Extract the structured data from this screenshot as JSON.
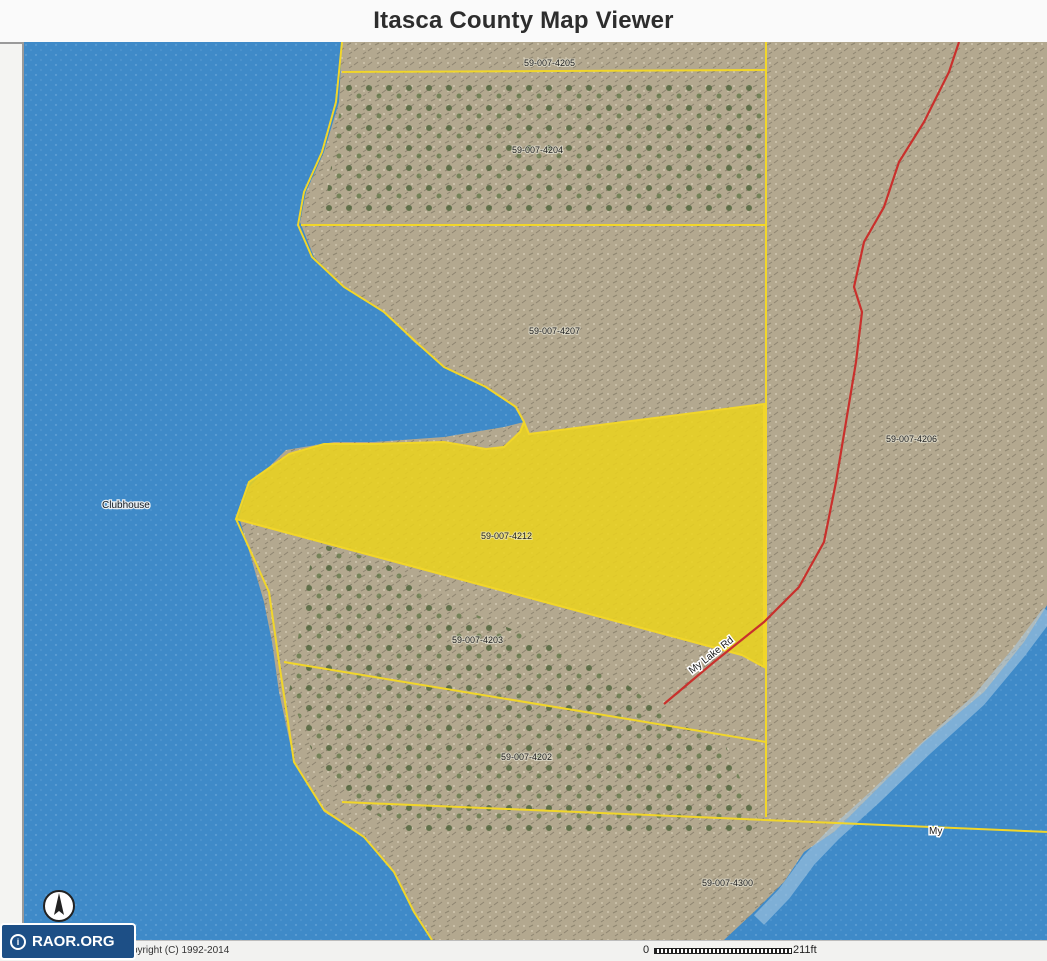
{
  "title": "Itasca County Map Viewer",
  "colors": {
    "water": "#3f8ac8",
    "land": "#b3a88f",
    "selected_parcel": "#e9d21f",
    "parcel_line": "#f1d62a",
    "road": "#c9302c"
  },
  "map": {
    "place_labels": {
      "clubhouse": "Clubhouse"
    },
    "road_labels": {
      "my_lake_rd": "My Lake Rd",
      "my": "My"
    },
    "parcels": {
      "p4205": "59-007-4205",
      "p4204": "59-007-4204",
      "p4207": "59-007-4207",
      "p4206": "59-007-4206",
      "p4212": "59-007-4212",
      "p4203": "59-007-4203",
      "p4202": "59-007-4202",
      "p4300": "59-007-4300"
    },
    "selected_parcel": "59-007-4212"
  },
  "footer": {
    "copyright": "pyright (C) 1992-2014",
    "scale_start": "0",
    "scale_distance": "211ft"
  },
  "watermark": {
    "text": "RAOR.ORG",
    "icon": "info-icon"
  },
  "north_arrow_icon": "north-arrow-icon"
}
